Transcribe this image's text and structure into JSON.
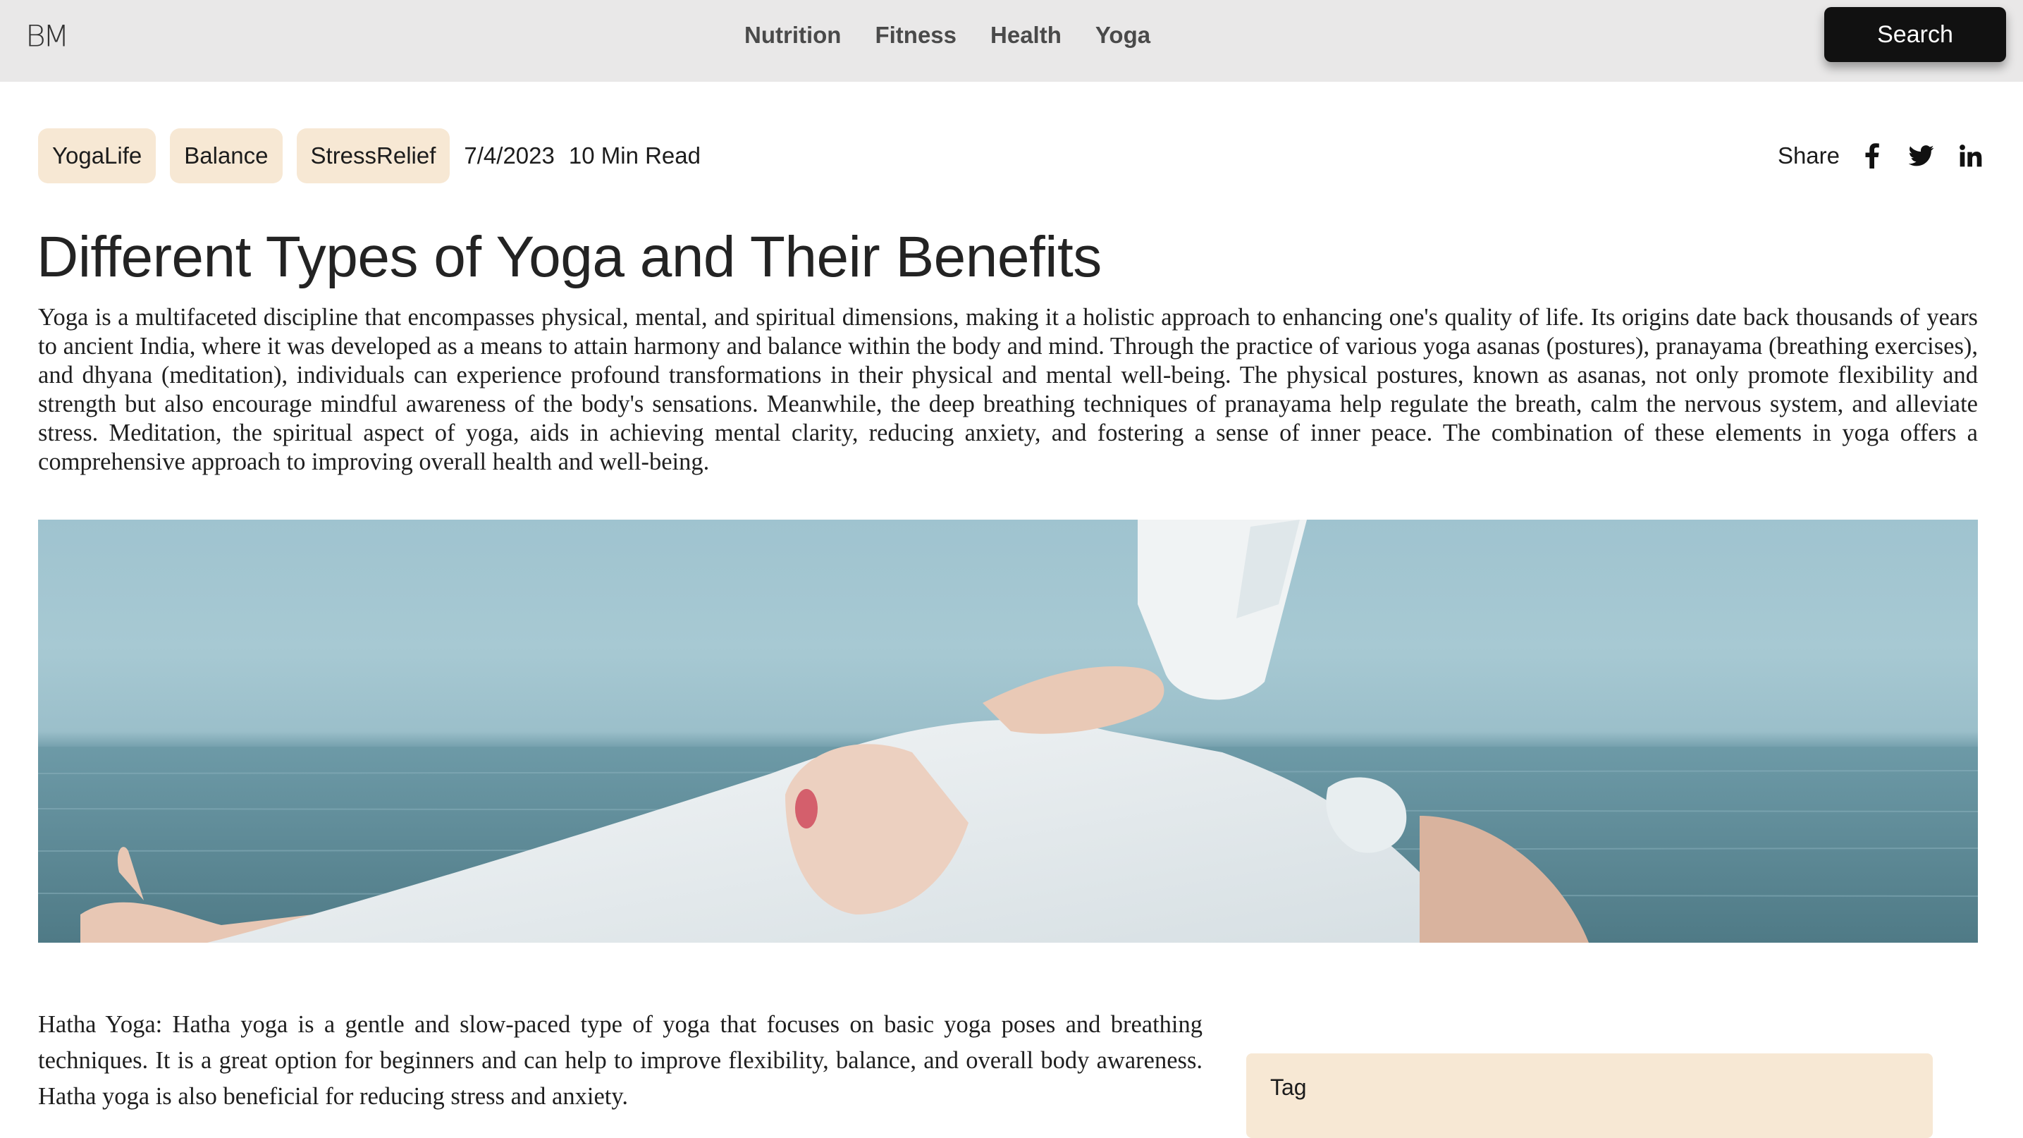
{
  "header": {
    "logo": "BM",
    "nav": [
      "Nutrition",
      "Fitness",
      "Health",
      "Yoga"
    ],
    "search_label": "Search"
  },
  "article": {
    "tags": [
      "YogaLife",
      "Balance",
      "StressRelief"
    ],
    "date": "7/4/2023",
    "read_time": "10 Min Read",
    "share_label": "Share",
    "share_icons": [
      "facebook-icon",
      "twitter-icon",
      "linkedin-icon"
    ],
    "title": "Different Types of Yoga and Their Benefits",
    "intro": "Yoga is a multifaceted discipline that encompasses physical, mental, and spiritual dimensions, making it a holistic approach to enhancing one's quality of life. Its origins date back thousands of years to ancient India, where it was developed as a means to attain harmony and balance within the body and mind. Through the practice of various yoga asanas (postures), pranayama (breathing exercises), and dhyana (meditation), individuals can experience profound transformations in their physical and mental well-being. The physical postures, known as asanas, not only promote flexibility and strength but also encourage mindful awareness of the body's sensations. Meanwhile, the deep breathing techniques of pranayama help regulate the breath, calm the nervous system, and alleviate stress. Meditation, the spiritual aspect of yoga, aids in achieving mental clarity, reducing anxiety, and fostering a sense of inner peace. The combination of these elements in yoga offers a comprehensive approach to improving overall health and well-being.",
    "hero_image": "woman in white shirt stretching by the sea",
    "body": "Hatha Yoga: Hatha yoga is a gentle and slow-paced type of yoga that focuses on basic yoga poses and breathing techniques. It is a great option for beginners and can help to improve flexibility, balance, and overall body awareness. Hatha yoga is also beneficial for reducing stress and anxiety."
  },
  "sidebar": {
    "heading": "Tag"
  },
  "colors": {
    "header_bg": "#e9e8e8",
    "tag_bg": "#f7e8d4",
    "button_bg": "#111111"
  }
}
